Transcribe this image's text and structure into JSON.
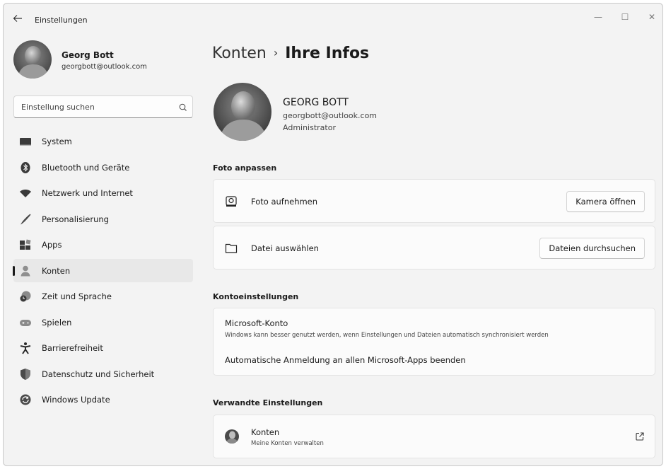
{
  "window": {
    "title": "Einstellungen",
    "controls": {
      "minimize": "—",
      "maximize": "☐",
      "close": "✕"
    }
  },
  "profile": {
    "name": "Georg Bott",
    "email": "georgbott@outlook.com"
  },
  "search": {
    "placeholder": "Einstellung suchen",
    "icon": "search-icon"
  },
  "sidebar": {
    "items": [
      {
        "label": "System",
        "icon": "monitor-icon"
      },
      {
        "label": "Bluetooth und Geräte",
        "icon": "bluetooth-icon"
      },
      {
        "label": "Netzwerk und Internet",
        "icon": "wifi-icon"
      },
      {
        "label": "Personalisierung",
        "icon": "brush-icon"
      },
      {
        "label": "Apps",
        "icon": "apps-icon"
      },
      {
        "label": "Konten",
        "icon": "person-icon",
        "active": true
      },
      {
        "label": "Zeit und Sprache",
        "icon": "clock-globe-icon"
      },
      {
        "label": "Spielen",
        "icon": "gamepad-icon"
      },
      {
        "label": "Barrierefreiheit",
        "icon": "accessibility-icon"
      },
      {
        "label": "Datenschutz und Sicherheit",
        "icon": "shield-icon"
      },
      {
        "label": "Windows Update",
        "icon": "update-icon"
      }
    ]
  },
  "breadcrumb": {
    "parent": "Konten",
    "separator": "›",
    "current": "Ihre Infos"
  },
  "user": {
    "name": "GEORG BOTT",
    "email": "georgbott@outlook.com",
    "role": "Administrator"
  },
  "photo": {
    "section_title": "Foto anpassen",
    "take_photo": {
      "label": "Foto aufnehmen",
      "button": "Kamera öffnen",
      "icon": "camera-icon"
    },
    "choose_file": {
      "label": "Datei auswählen",
      "button": "Dateien durchsuchen",
      "icon": "folder-icon"
    }
  },
  "account_settings": {
    "section_title": "Kontoeinstellungen",
    "title": "Microsoft-Konto",
    "description": "Windows kann besser genutzt werden, wenn Einstellungen und Dateien automatisch synchronisiert werden",
    "action": "Automatische Anmeldung an allen Microsoft-Apps beenden"
  },
  "related": {
    "section_title": "Verwandte Einstellungen",
    "title": "Konten",
    "description": "Meine Konten verwalten",
    "icon": "external-link-icon"
  },
  "colors": {
    "window_bg": "#f3f3f3",
    "card_bg": "#fbfbfb",
    "active_item": "#e8e8e8",
    "text": "#1a1a1a"
  }
}
